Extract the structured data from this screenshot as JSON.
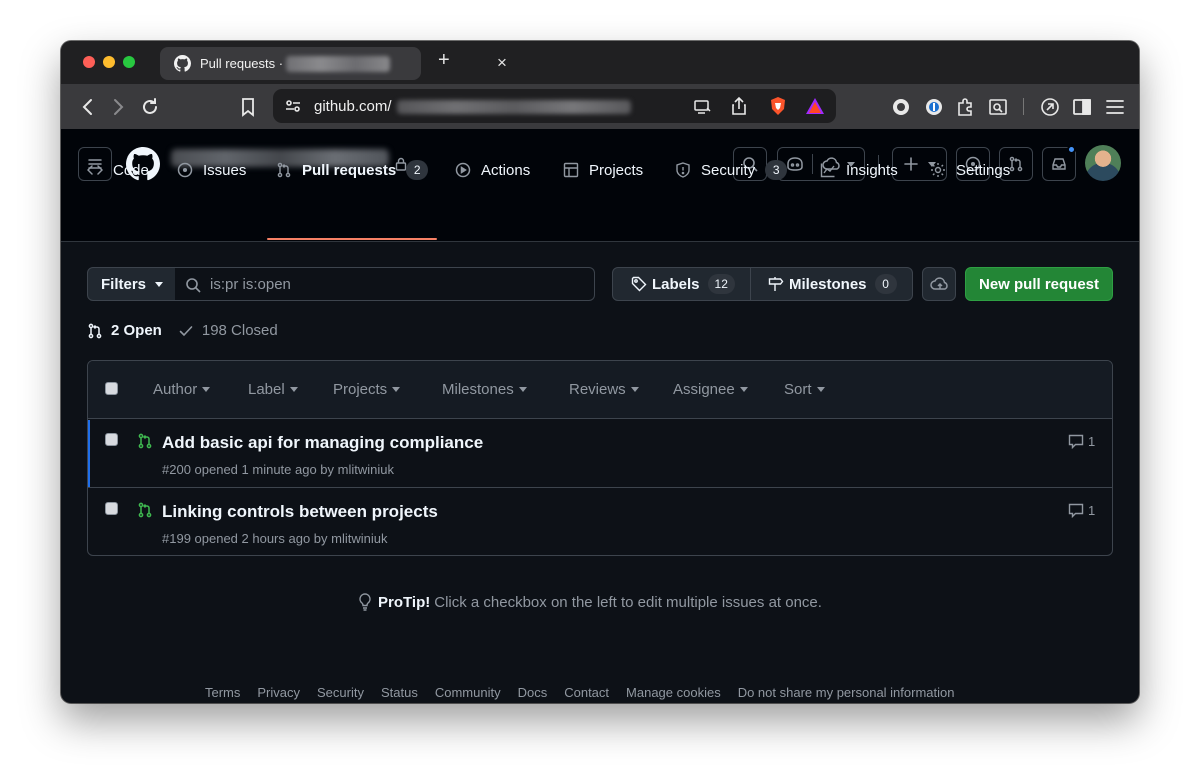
{
  "browser": {
    "tab_title": "Pull requests ·",
    "url": "github.com/",
    "new_tab_glyph": "+",
    "close_glyph": "×"
  },
  "repo_nav": [
    {
      "label": "Code",
      "icon": "code-icon"
    },
    {
      "label": "Issues",
      "icon": "issue-icon"
    },
    {
      "label": "Pull requests",
      "icon": "pull-request-icon",
      "count": "2",
      "active": true
    },
    {
      "label": "Actions",
      "icon": "play-icon"
    },
    {
      "label": "Projects",
      "icon": "table-icon"
    },
    {
      "label": "Security",
      "icon": "shield-icon",
      "count": "3"
    },
    {
      "label": "Insights",
      "icon": "graph-icon"
    },
    {
      "label": "Settings",
      "icon": "gear-icon"
    }
  ],
  "toolbar": {
    "filters_label": "Filters",
    "search_value": "is:pr is:open",
    "labels_label": "Labels",
    "labels_count": "12",
    "milestones_label": "Milestones",
    "milestones_count": "0",
    "new_pr_label": "New pull request"
  },
  "states": {
    "open": "2 Open",
    "closed": "198 Closed"
  },
  "list_filters": [
    "Author",
    "Label",
    "Projects",
    "Milestones",
    "Reviews",
    "Assignee",
    "Sort"
  ],
  "pull_requests": [
    {
      "title": "Add basic api for managing compliance",
      "meta": "#200 opened 1 minute ago by mlitwiniuk",
      "comments": "1"
    },
    {
      "title": "Linking controls between projects",
      "meta": "#199 opened 2 hours ago by mlitwiniuk",
      "comments": "1"
    }
  ],
  "protip": {
    "label": "ProTip!",
    "text": "Click a checkbox on the left to edit multiple issues at once."
  },
  "footer": [
    "Terms",
    "Privacy",
    "Security",
    "Status",
    "Community",
    "Docs",
    "Contact",
    "Manage cookies",
    "Do not share my personal information"
  ],
  "colors": {
    "accent_green": "#238636",
    "open_icon": "#3fb950",
    "nav_underline": "#f78166",
    "notification_dot": "#4493f8"
  }
}
